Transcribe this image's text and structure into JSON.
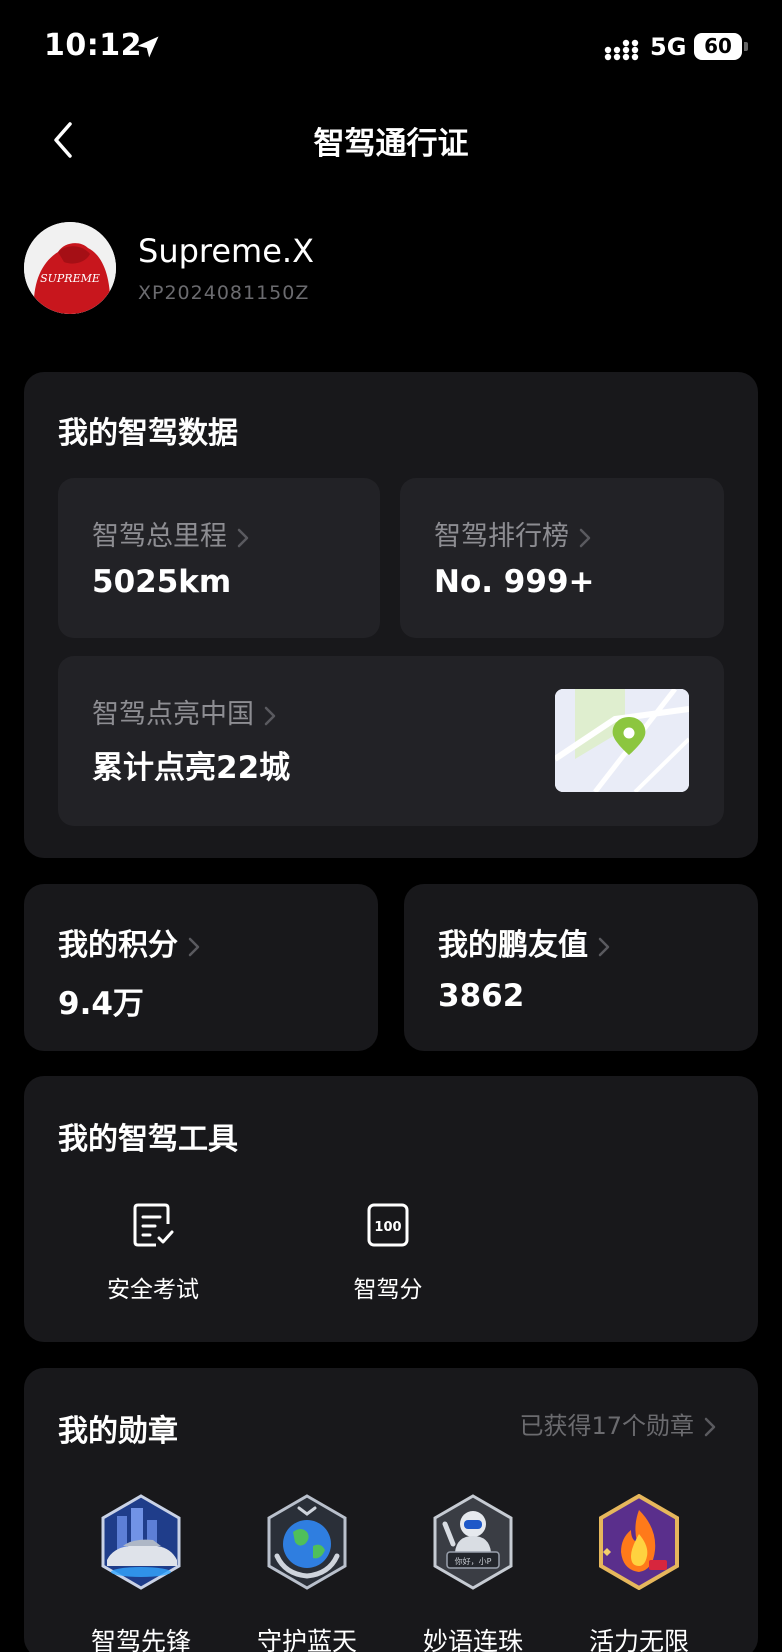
{
  "status_bar": {
    "time": "10:12",
    "network": "5G",
    "battery": "60"
  },
  "nav": {
    "title": "智驾通行证"
  },
  "profile": {
    "name": "Supreme.X",
    "id": "XP2024081150Z",
    "avatar_text": "SUPREME"
  },
  "driving_data": {
    "title": "我的智驾数据",
    "total_mileage": {
      "label": "智驾总里程",
      "value": "5025km"
    },
    "ranking": {
      "label": "智驾排行榜",
      "value": "No. 999+"
    },
    "light_china": {
      "label": "智驾点亮中国",
      "value": "累计点亮22城"
    }
  },
  "points": {
    "label": "我的积分",
    "value": "9.4万"
  },
  "friend_value": {
    "label": "我的鹏友值",
    "value": "3862"
  },
  "tools": {
    "title": "我的智驾工具",
    "items": [
      {
        "label": "安全考试",
        "icon": "exam-icon"
      },
      {
        "label": "智驾分",
        "icon": "score-icon",
        "icon_text": "100"
      }
    ]
  },
  "medals": {
    "title": "我的勋章",
    "summary": "已获得17个勋章",
    "items": [
      {
        "label": "智驾先锋",
        "icon": "car-city-medal-icon"
      },
      {
        "label": "守护蓝天",
        "icon": "earth-medal-icon"
      },
      {
        "label": "妙语连珠",
        "icon": "robot-medal-icon",
        "sign_text": "你好，小P"
      },
      {
        "label": "活力无限",
        "icon": "fire-medal-icon"
      }
    ]
  },
  "colors": {
    "background": "#000000",
    "card": "#18181b",
    "inner_card": "#222226",
    "muted_text": "#8d8d92",
    "map_pin": "#8cc63f"
  }
}
